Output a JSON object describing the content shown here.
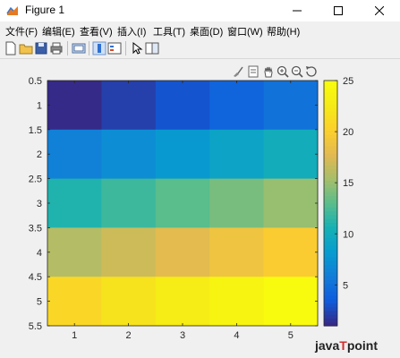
{
  "window": {
    "title": "Figure 1"
  },
  "menu": [
    "文件(F)",
    "编辑(E)",
    "查看(V)",
    "插入(I)",
    "工具(T)",
    "桌面(D)",
    "窗口(W)",
    "帮助(H)"
  ],
  "toolbar_icons": [
    "new-figure-icon",
    "open-file-icon",
    "save-icon",
    "print-icon",
    "link-plot-icon",
    "insert-colorbar-icon",
    "insert-legend-icon",
    "edit-plot-icon",
    "property-inspector-icon"
  ],
  "axes_toolbar_icons": [
    "brush-icon",
    "data-tips-icon",
    "pan-icon",
    "zoom-in-icon",
    "zoom-out-icon",
    "restore-view-icon"
  ],
  "chart_data": {
    "type": "heatmap",
    "x": [
      1,
      2,
      3,
      4,
      5
    ],
    "y": [
      1,
      2,
      3,
      4,
      5
    ],
    "values": [
      [
        1,
        2,
        3,
        4,
        5
      ],
      [
        6,
        7,
        8,
        9,
        10
      ],
      [
        11,
        12,
        13,
        14,
        15
      ],
      [
        16,
        17,
        18,
        19,
        20
      ],
      [
        21,
        22,
        23,
        24,
        25
      ]
    ],
    "xlim": [
      0.5,
      5.5
    ],
    "ylim": [
      0.5,
      5.5
    ],
    "y_direction": "reverse",
    "xticks": [
      "1",
      "2",
      "3",
      "4",
      "5"
    ],
    "yticks": [
      "0.5",
      "1",
      "1.5",
      "2",
      "2.5",
      "3",
      "3.5",
      "4",
      "4.5",
      "5",
      "5.5"
    ],
    "colormap": "parula",
    "clim": [
      1,
      25
    ],
    "colorbar_ticks": [
      "5",
      "10",
      "15",
      "20",
      "25"
    ]
  },
  "watermark": {
    "text_left": "java",
    "text_v": "T",
    "text_right": "point"
  }
}
